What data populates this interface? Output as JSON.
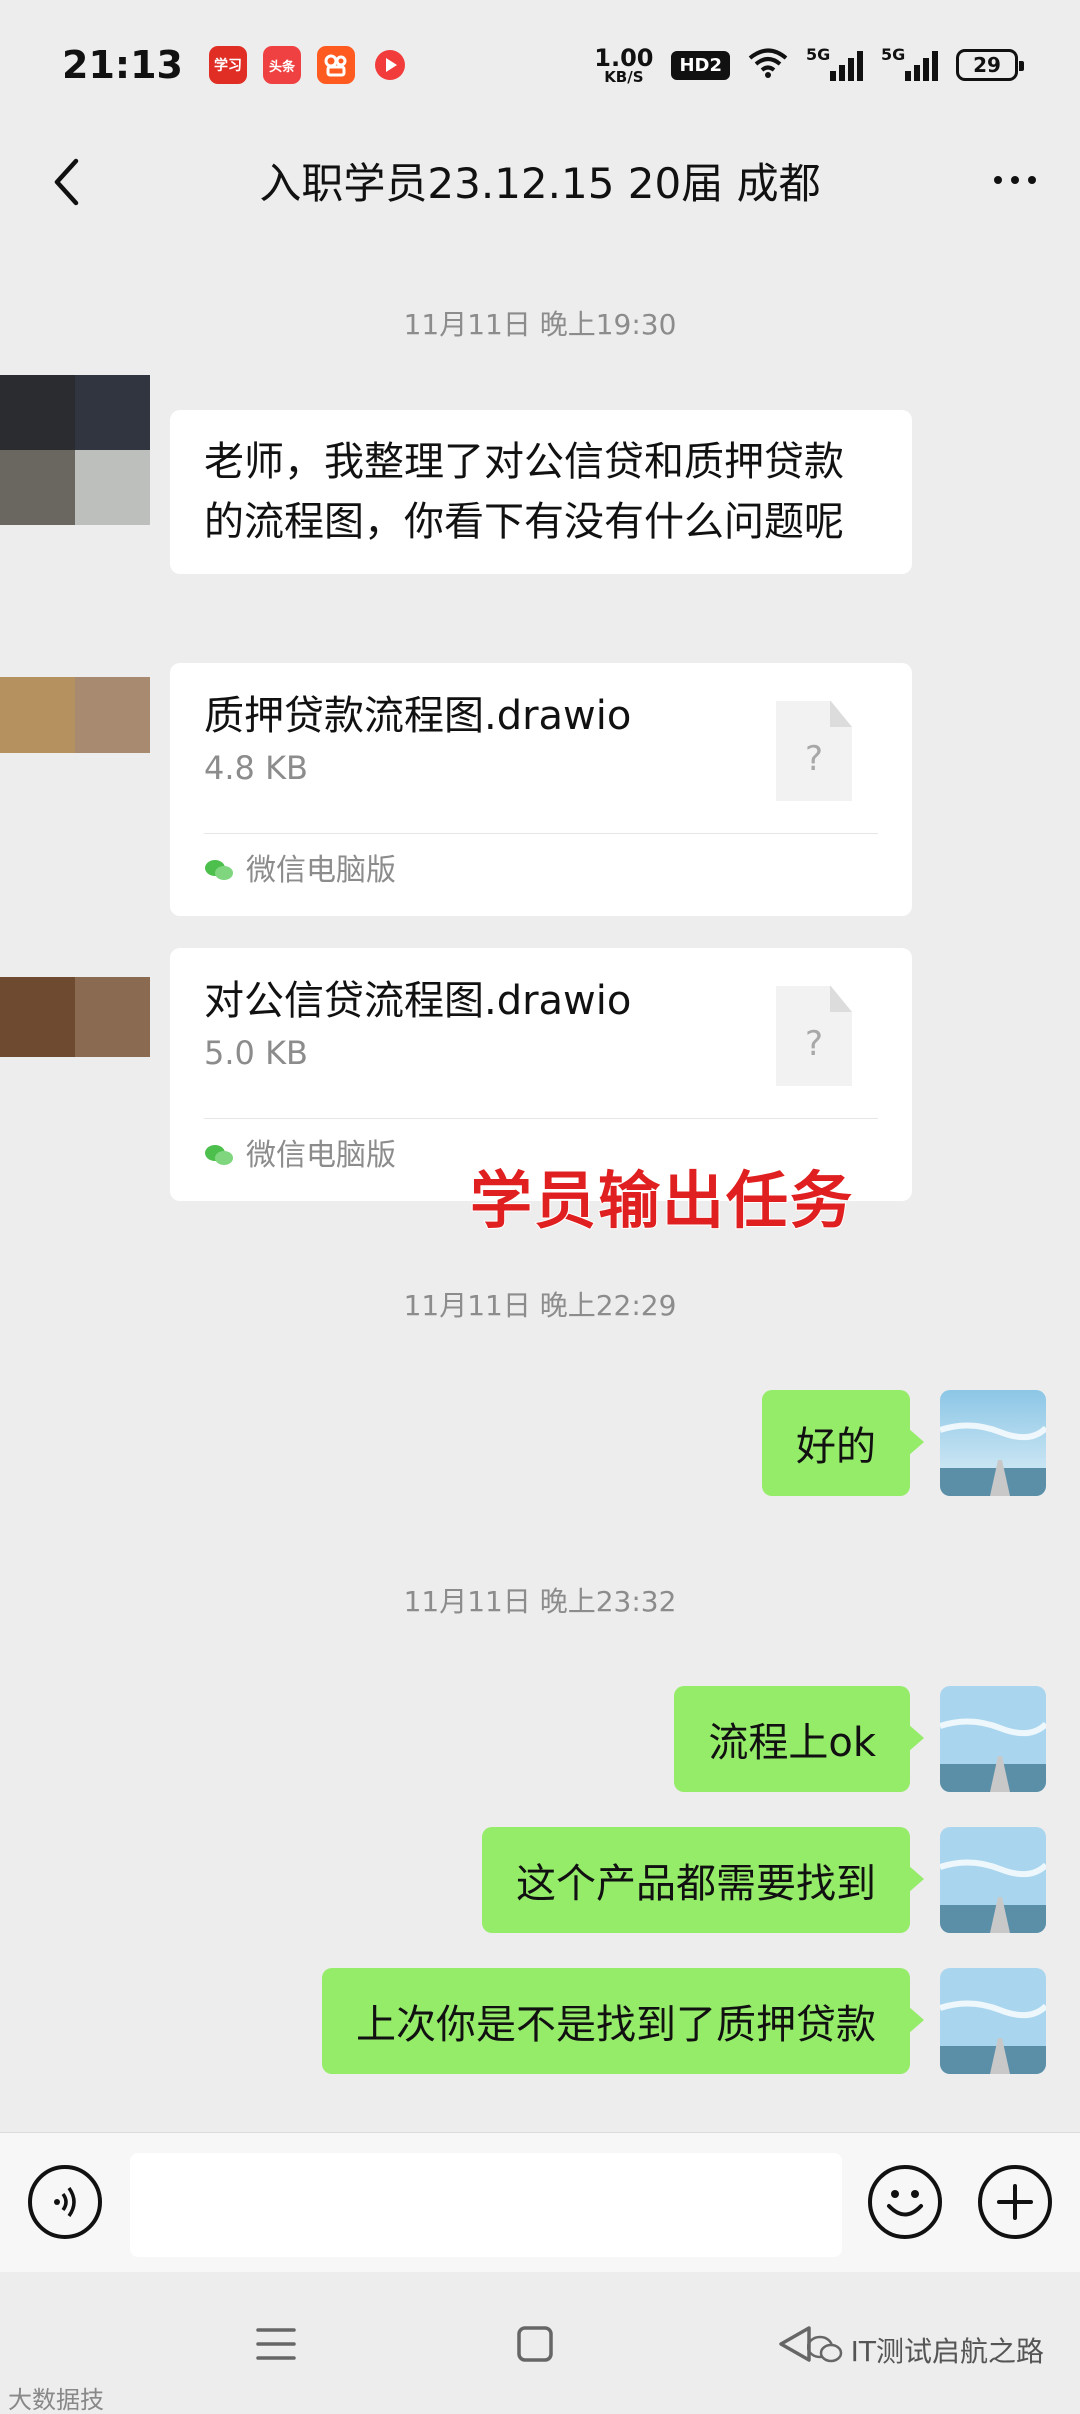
{
  "status_bar": {
    "time": "21:13",
    "app_icons": [
      {
        "name": "xuexi-app-icon",
        "label": "学习",
        "color": "#e02e24"
      },
      {
        "name": "toutiao-app-icon",
        "label": "头条",
        "color": "#f04142"
      },
      {
        "name": "kuaishou-app-icon",
        "label": "",
        "color": "#ff5a1f"
      },
      {
        "name": "video-app-icon",
        "label": "",
        "color": "#f23c3c"
      }
    ],
    "net_speed": "1.00",
    "net_speed_unit": "KB/S",
    "hd_badge": "HD2",
    "signal1_label": "5G",
    "signal2_label": "5G",
    "battery": "29"
  },
  "header": {
    "title": "入职学员23.12.15 20届  成都"
  },
  "messages": {
    "ts1": "11月11日 晚上19:30",
    "msg1_text": "老师，我整理了对公信贷和质押贷款的流程图，你看下有没有什么问题呢",
    "file1": {
      "name": "质押贷款流程图.drawio",
      "size": "4.8 KB",
      "source": "微信电脑版"
    },
    "file2": {
      "name": "对公信贷流程图.drawio",
      "size": "5.0 KB",
      "source": "微信电脑版"
    },
    "overlay": "学员输出任务",
    "ts2": "11月11日 晚上22:29",
    "reply1": "好的",
    "ts3": "11月11日 晚上23:32",
    "reply2": "流程上ok",
    "reply3": "这个产品都需要找到",
    "reply4": "上次你是不是找到了质押贷款"
  },
  "input_bar": {
    "placeholder": ""
  },
  "watermarks": {
    "right": "IT测试启航之路",
    "left": "大数据技"
  },
  "colors": {
    "sent_bubble": "#95ec69",
    "received_bubble": "#ffffff",
    "background": "#ededed",
    "overlay_red": "#e02020"
  }
}
